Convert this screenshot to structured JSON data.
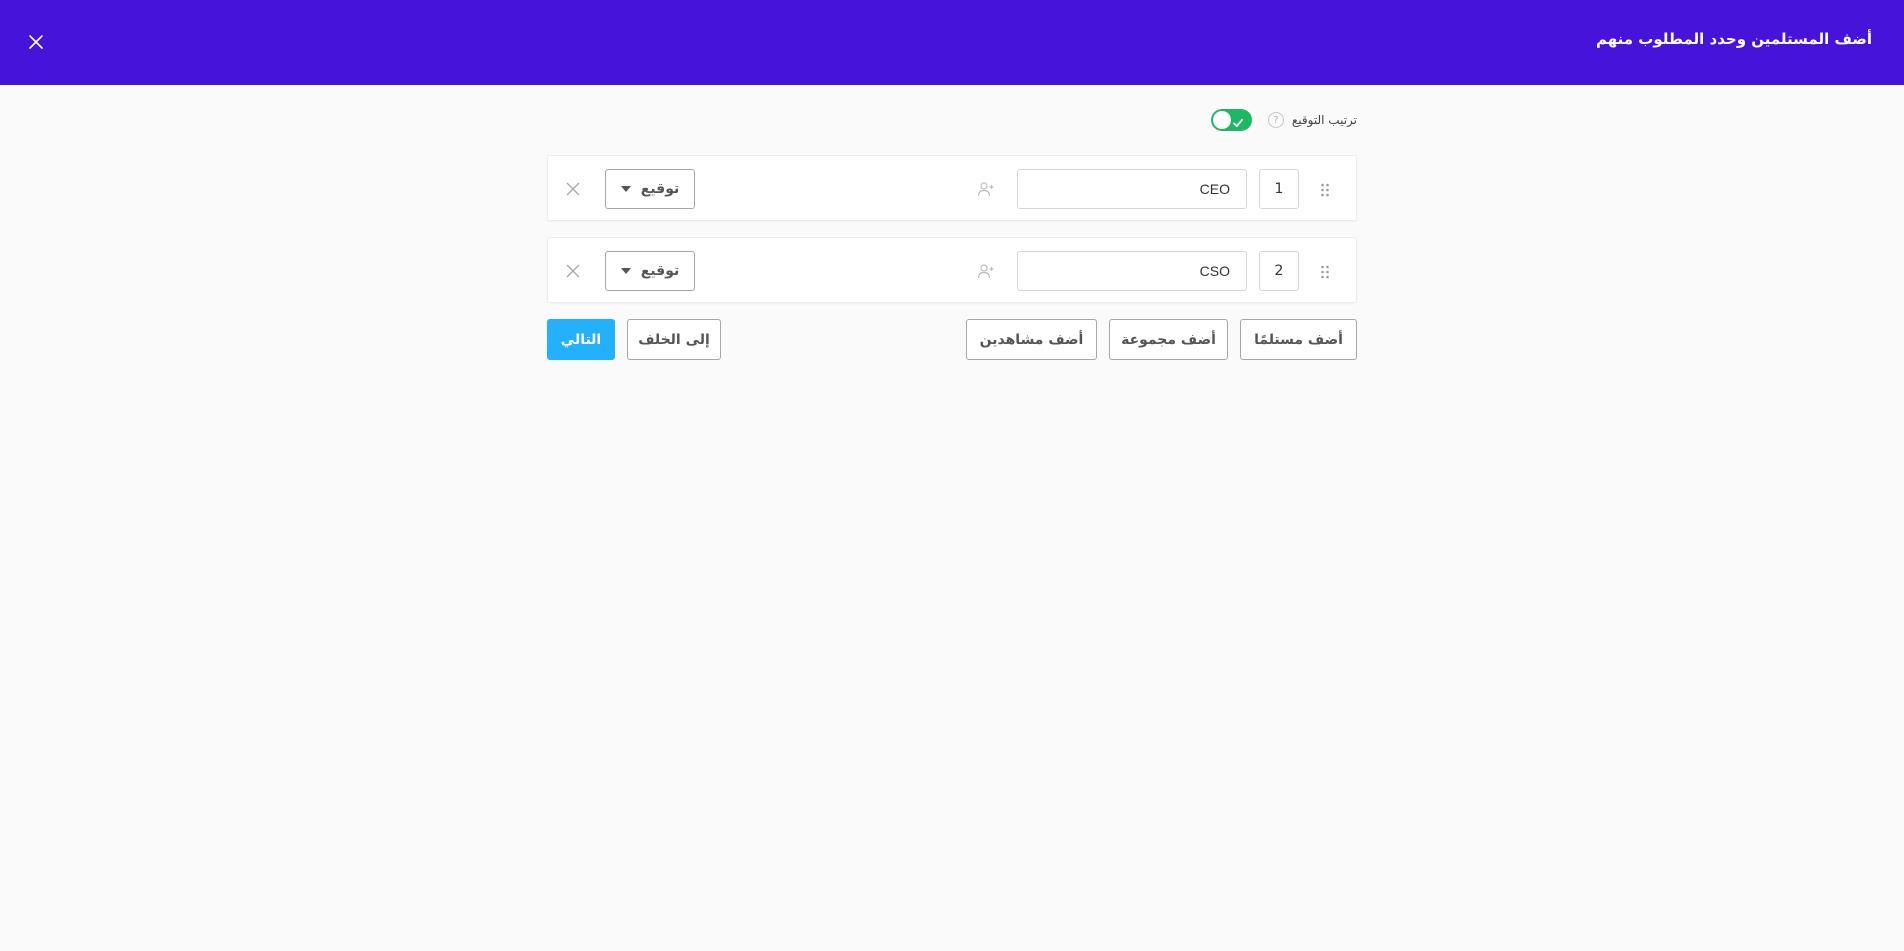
{
  "header": {
    "title": "أضف المستلمين وحدد المطلوب منهم",
    "close_icon": "close-icon"
  },
  "signing_order": {
    "label": "ترتيب التوقيع",
    "help_icon": "help-icon",
    "help_symbol": "?",
    "enabled": true,
    "toggle_color": "#1db863"
  },
  "recipients": [
    {
      "order": "1",
      "role": "CEO",
      "action": "توقيع"
    },
    {
      "order": "2",
      "role": "CSO",
      "action": "توقيع"
    }
  ],
  "buttons": {
    "add_recipient": "أضف مستلمًا",
    "add_group": "أضف مجموعة",
    "add_viewers": "أضف مشاهدين",
    "back": "إلى الخلف",
    "next": "التالي"
  },
  "colors": {
    "header_bg": "#4513d9",
    "primary": "#22b0ff",
    "background": "#fafafa"
  }
}
